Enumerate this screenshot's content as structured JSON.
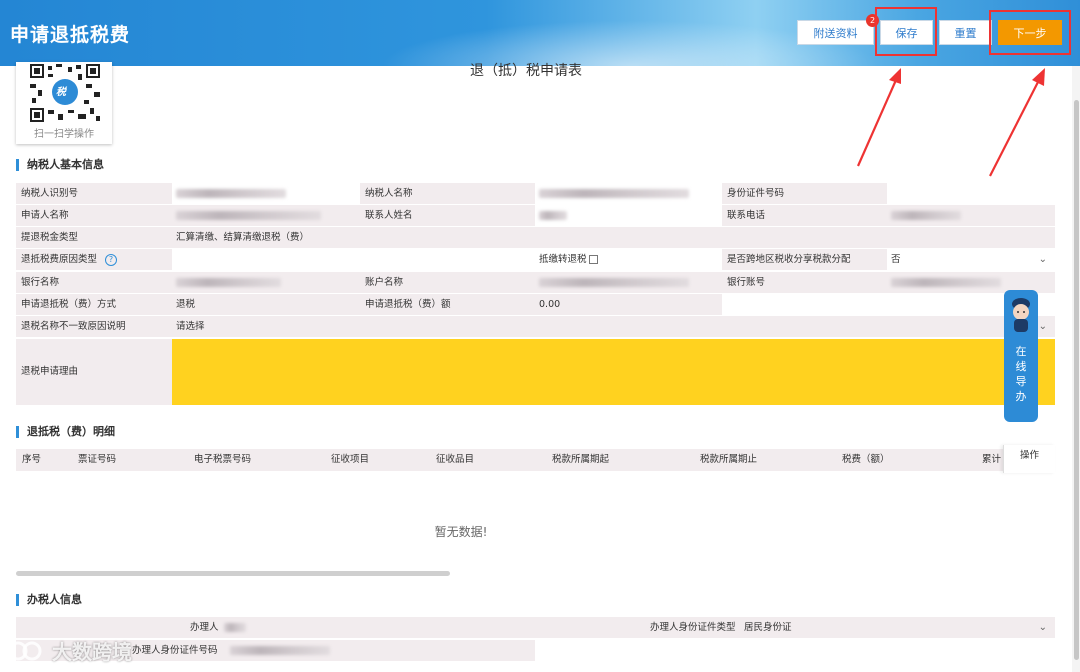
{
  "header": {
    "title": "申请退抵税费",
    "buttons": {
      "attach": "附送资料",
      "save": "保存",
      "reset": "重置",
      "next": "下一步"
    },
    "save_badge": "2"
  },
  "qr": {
    "label": "扫一扫学操作",
    "logo_text": "税"
  },
  "form_title": "退（抵）税申请表",
  "taxpayer_section": {
    "title": "纳税人基本信息",
    "taxpayer_id_label": "纳税人识别号",
    "taxpayer_name_label": "纳税人名称",
    "id_number_label": "身份证件号码",
    "applicant_name_label": "申请人名称",
    "contact_name_label": "联系人姓名",
    "contact_phone_label": "联系电话",
    "refund_type_label": "提退税金类型",
    "refund_type_value": "汇算清缴、结算清缴退税（费）",
    "reason_type_label": "退抵税费原因类型",
    "convert_label": "抵缴转退税",
    "cross_region_label": "是否跨地区税收分享税款分配",
    "cross_region_value": "否",
    "bank_name_label": "银行名称",
    "account_name_label": "账户名称",
    "bank_account_label": "银行账号",
    "method_label": "申请退抵税（费）方式",
    "method_value": "退税",
    "amount_label": "申请退抵税（费）额",
    "amount_value": "0.00",
    "mismatch_label": "退税名称不一致原因说明",
    "mismatch_value": "请选择",
    "reason_label": "退税申请理由"
  },
  "detail_section": {
    "title": "退抵税（费）明细",
    "columns": [
      "序号",
      "票证号码",
      "电子税票号码",
      "征收项目",
      "征收品目",
      "税款所属期起",
      "税款所属期止",
      "税费（额）",
      "累计"
    ],
    "op_column": "操作",
    "empty_text": "暂无数据!"
  },
  "agent_section": {
    "title": "办税人信息",
    "agent_label": "办理人",
    "agent_id_type_label": "办理人身份证件类型",
    "agent_id_type_value": "居民身份证",
    "agent_id_number_label": "办理人身份证件号码"
  },
  "floating_service": {
    "label": "在线导办"
  },
  "watermark": "大数跨境",
  "colors": {
    "header_blue": "#2f95dd",
    "accent_orange": "#f39800",
    "highlight_yellow": "#ffd21f",
    "annotation_red": "#e33333",
    "label_bg": "#f2ecee"
  }
}
